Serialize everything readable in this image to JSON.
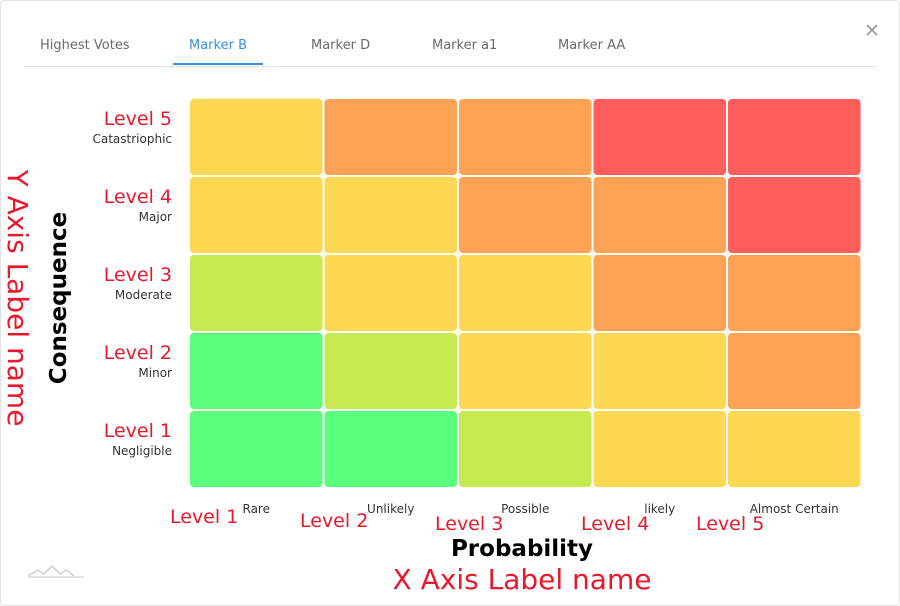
{
  "tabs": [
    {
      "label": "Highest Votes",
      "active": false
    },
    {
      "label": "Marker B",
      "active": true
    },
    {
      "label": "Marker D",
      "active": false
    },
    {
      "label": "Marker a1",
      "active": false
    },
    {
      "label": "Marker AA",
      "active": false
    }
  ],
  "close_icon": "close-icon",
  "logo_icon": "mountain-logo-icon",
  "chart_data": {
    "type": "heatmap",
    "xlabel": "Probability",
    "ylabel": "Consequence",
    "x_categories": [
      {
        "name": "Rare",
        "level": "Level 1"
      },
      {
        "name": "Unlikely",
        "level": "Level 2"
      },
      {
        "name": "Possible",
        "level": "Level 3"
      },
      {
        "name": "likely",
        "level": "Level 4"
      },
      {
        "name": "Almost Certain",
        "level": "Level 5"
      }
    ],
    "y_categories": [
      {
        "name": "Negligible",
        "level": "Level 1"
      },
      {
        "name": "Minor",
        "level": "Level 2"
      },
      {
        "name": "Moderate",
        "level": "Level 3"
      },
      {
        "name": "Major",
        "level": "Level 4"
      },
      {
        "name": "Catastriophic",
        "level": "Level 5"
      }
    ],
    "rows_top_to_bottom": [
      [
        "#fed852",
        "#fea356",
        "#fea356",
        "#ff5e5a",
        "#ff5e5a"
      ],
      [
        "#fed852",
        "#fed852",
        "#fea356",
        "#fea356",
        "#ff5e5a"
      ],
      [
        "#c6ea50",
        "#fed852",
        "#fed852",
        "#fea356",
        "#fea356"
      ],
      [
        "#5bfe7c",
        "#c6ea50",
        "#fed852",
        "#fed852",
        "#fea356"
      ],
      [
        "#5bfe7c",
        "#5bfe7c",
        "#c6ea50",
        "#fed852",
        "#fed852"
      ]
    ],
    "annotations": {
      "x_axis_note": "X Axis Label name",
      "y_axis_note": "Y Axis Label name"
    },
    "grid": false,
    "legend": "none"
  },
  "colors": {
    "accent": "#3a8fd6",
    "annotation_red": "#e8192c"
  }
}
